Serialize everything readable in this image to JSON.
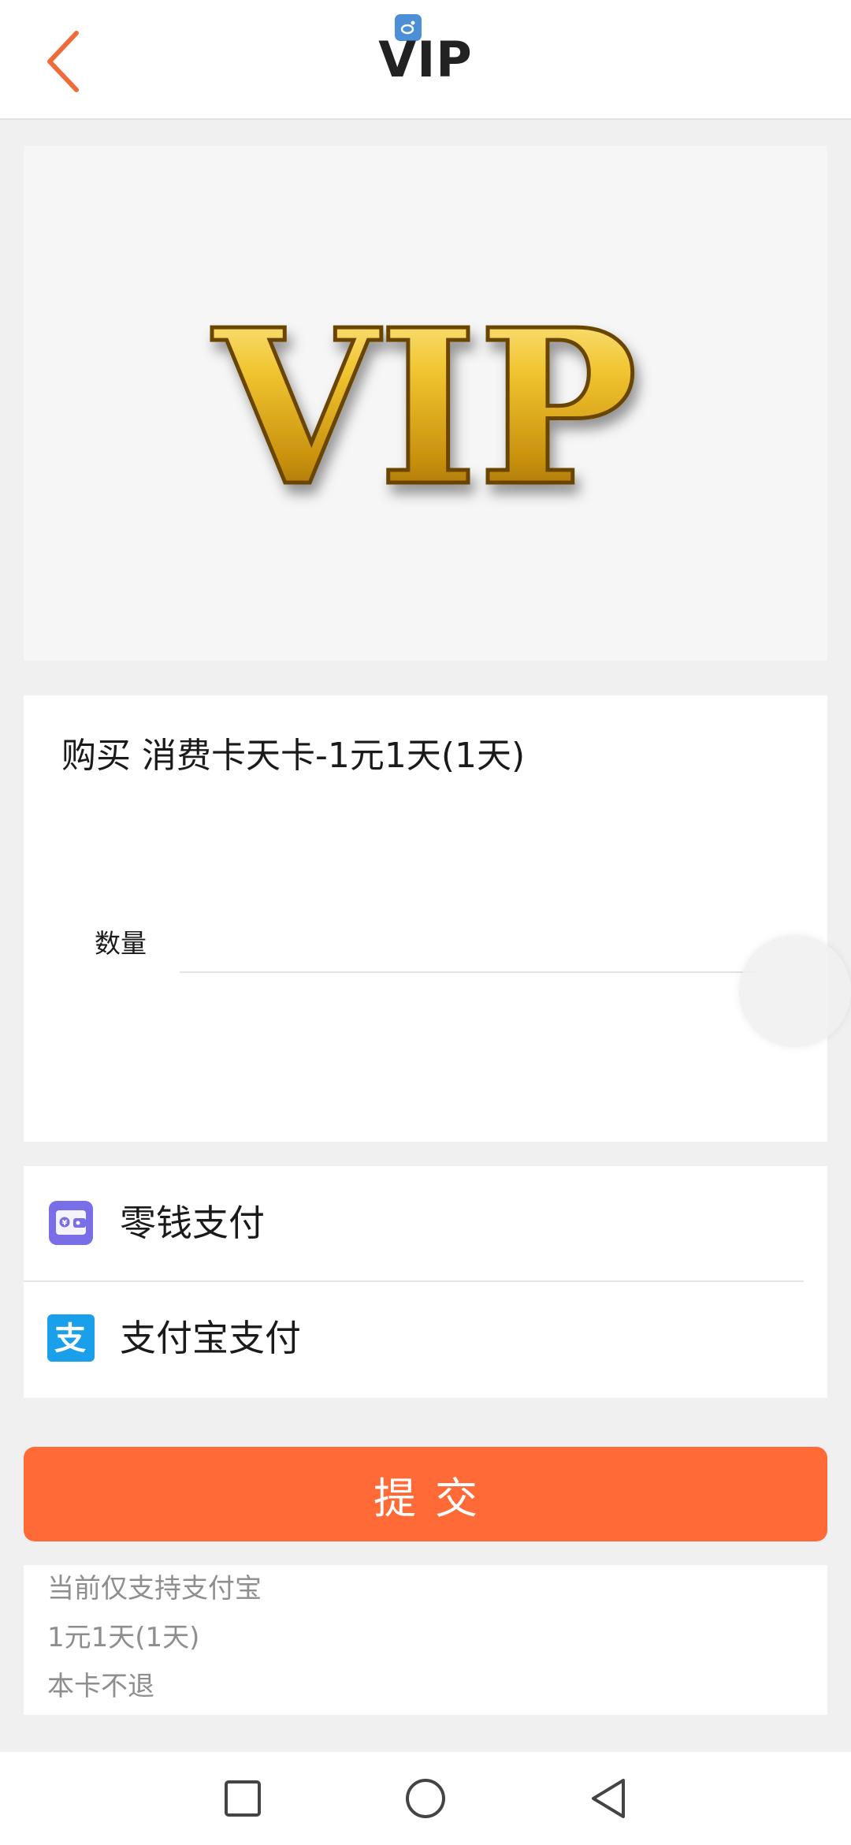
{
  "header": {
    "title": "VIP",
    "back_icon": "chevron-left-icon",
    "accent_color": "#f06a3a"
  },
  "banner": {
    "text": "VIP",
    "gold_color": "#e8b820"
  },
  "product": {
    "title": "购买 消费卡天卡-1元1天(1天)",
    "quantity_label": "数量",
    "quantity_value": ""
  },
  "payment": {
    "options": [
      {
        "label": "零钱支付",
        "icon": "wallet-icon",
        "color": "#7a6ee8"
      },
      {
        "label": "支付宝支付",
        "icon": "alipay-icon",
        "color": "#1aa0ea"
      }
    ]
  },
  "submit": {
    "label": "提交",
    "color": "#ff6a36"
  },
  "notes": [
    "当前仅支持支付宝",
    "1元1天(1天)",
    "本卡不退"
  ],
  "navbar": {
    "icons": [
      "recent-apps-icon",
      "home-icon",
      "back-icon"
    ]
  }
}
